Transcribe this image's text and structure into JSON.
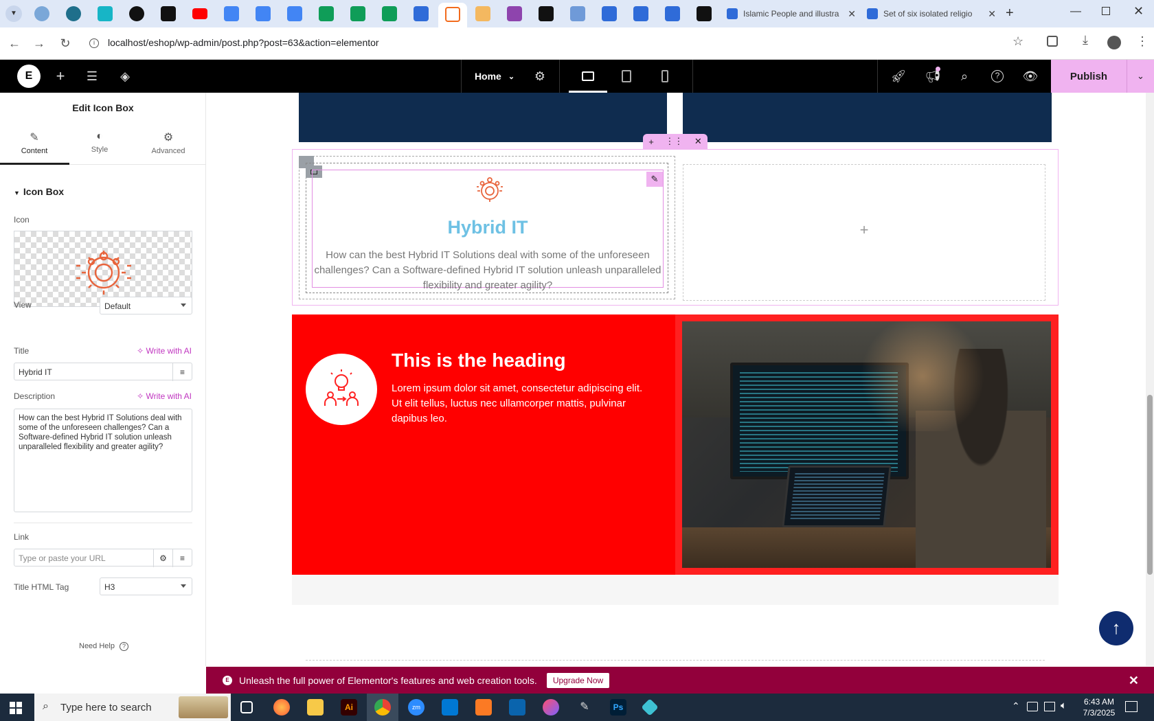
{
  "browser": {
    "tabs": [
      {
        "title": "Islamic People and illustra"
      },
      {
        "title": "Set of six isolated religio"
      }
    ],
    "url": "localhost/eshop/wp-admin/post.php?post=63&action=elementor"
  },
  "editor_topbar": {
    "page_selector": "Home",
    "publish_label": "Publish"
  },
  "panel": {
    "title": "Edit Icon Box",
    "tabs": [
      {
        "label": "Content",
        "icon": "pencil-icon"
      },
      {
        "label": "Style",
        "icon": "half-circle-icon"
      },
      {
        "label": "Advanced",
        "icon": "gear-icon"
      }
    ],
    "section_title": "Icon Box",
    "icon_label": "Icon",
    "view_label": "View",
    "view_value": "Default",
    "title_label": "Title",
    "write_ai": "Write with AI",
    "title_value": "Hybrid IT",
    "description_label": "Description",
    "description_value": "How can the best Hybrid IT Solutions deal with some of the unforeseen challenges? Can a Software-defined Hybrid IT solution unleash unparalleled flexibility and greater agility?",
    "link_label": "Link",
    "link_placeholder": "Type or paste your URL",
    "html_tag_label": "Title HTML Tag",
    "html_tag_value": "H3",
    "need_help": "Need Help"
  },
  "canvas": {
    "icon_box": {
      "title": "Hybrid IT",
      "description": "How can the best Hybrid IT Solutions deal with some of the unforeseen challenges? Can a Software-defined Hybrid IT solution unleash unparalleled flexibility and greater agility?"
    },
    "hero": {
      "heading": "This is the heading",
      "text": "Lorem ipsum dolor sit amet, consectetur adipiscing elit. Ut elit tellus, luctus nec ullamcorper mattis, pulvinar dapibus leo."
    }
  },
  "upgrade_banner": {
    "text": "Unleash the full power of Elementor's features and web creation tools.",
    "button": "Upgrade Now"
  },
  "taskbar": {
    "search_placeholder": "Type here to search",
    "time": "6:43 AM",
    "date": "7/3/2025"
  },
  "colors": {
    "accent_pink": "#f0b3f0",
    "navy": "#0f2c4f",
    "red": "#ff0000",
    "title_blue": "#6ec1e4",
    "icon_orange": "#e8643c"
  }
}
